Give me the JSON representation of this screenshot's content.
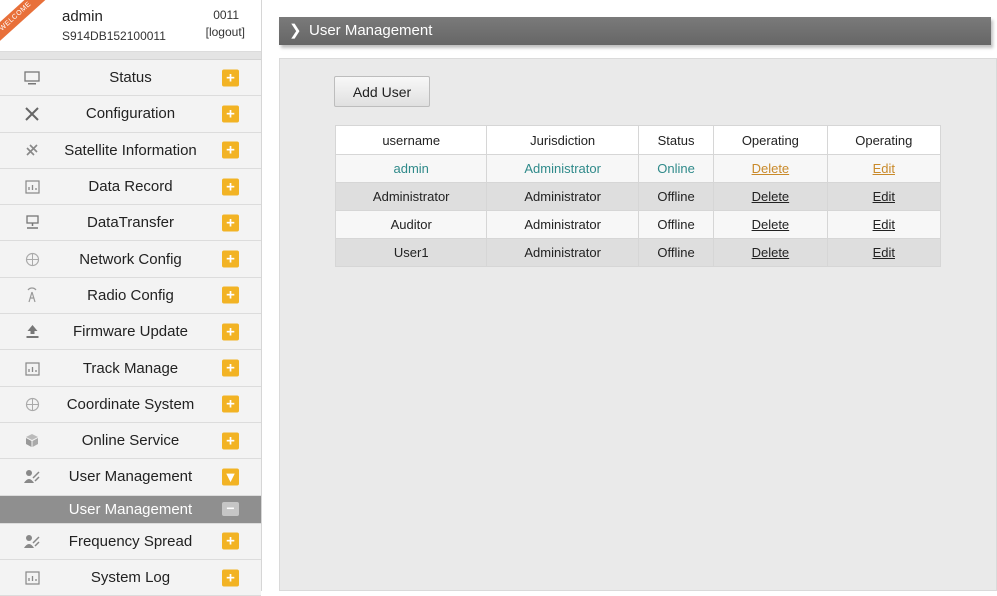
{
  "user": {
    "welcome": "WELCOME",
    "name": "admin",
    "serial": "S914DB152100011",
    "code": "0011",
    "logout": "[logout]"
  },
  "nav": [
    {
      "label": "Status",
      "icon": "monitor-icon",
      "toggle": "+"
    },
    {
      "label": "Configuration",
      "icon": "tools-icon",
      "toggle": "+"
    },
    {
      "label": "Satellite Information",
      "icon": "satellite-icon",
      "toggle": "+"
    },
    {
      "label": "Data Record",
      "icon": "calendar-icon",
      "toggle": "+"
    },
    {
      "label": "DataTransfer",
      "icon": "network-icon",
      "toggle": "+"
    },
    {
      "label": "Network Config",
      "icon": "globe-icon",
      "toggle": "+"
    },
    {
      "label": "Radio Config",
      "icon": "antenna-icon",
      "toggle": "+"
    },
    {
      "label": "Firmware Update",
      "icon": "upload-icon",
      "toggle": "+"
    },
    {
      "label": "Track Manage",
      "icon": "calendar-icon",
      "toggle": "+"
    },
    {
      "label": "Coordinate System",
      "icon": "globe-icon",
      "toggle": "+"
    },
    {
      "label": "Online Service",
      "icon": "cube-icon",
      "toggle": "+"
    },
    {
      "label": "User Management",
      "icon": "users-icon",
      "toggle": "▾"
    },
    {
      "label": "User Management",
      "sub": true,
      "toggle": "−"
    },
    {
      "label": "Frequency Spread",
      "icon": "users-icon",
      "toggle": "+"
    },
    {
      "label": "System Log",
      "icon": "calendar-icon",
      "toggle": "+"
    }
  ],
  "header": {
    "title": "User Management"
  },
  "main": {
    "add_user_label": "Add User",
    "columns": [
      "username",
      "Jurisdiction",
      "Status",
      "Operating",
      "Operating"
    ],
    "rows": [
      {
        "username": "admin",
        "jurisdiction": "Administrator",
        "status": "Online",
        "delete": "Delete",
        "edit": "Edit"
      },
      {
        "username": "Administrator",
        "jurisdiction": "Administrator",
        "status": "Offline",
        "delete": "Delete",
        "edit": "Edit"
      },
      {
        "username": "Auditor",
        "jurisdiction": "Administrator",
        "status": "Offline",
        "delete": "Delete",
        "edit": "Edit"
      },
      {
        "username": "User1",
        "jurisdiction": "Administrator",
        "status": "Offline",
        "delete": "Delete",
        "edit": "Edit"
      }
    ]
  },
  "colors": {
    "accent": "#f2b324",
    "header": "#6e6e6e",
    "active_text": "#2f8a8a",
    "active_link": "#c98a2a"
  }
}
